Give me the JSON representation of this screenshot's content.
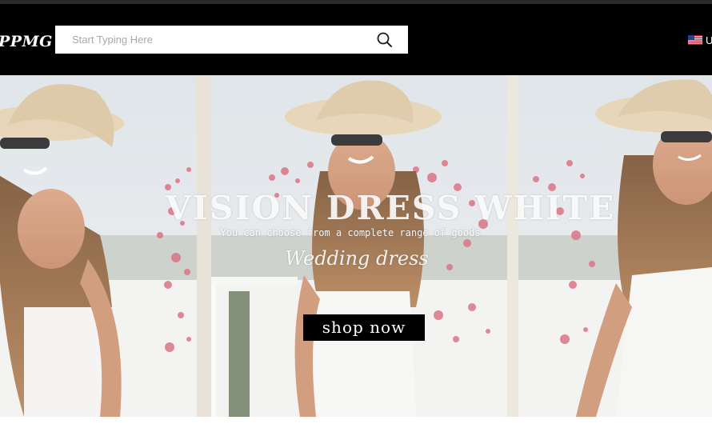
{
  "header": {
    "logo_text": "PPMG",
    "search": {
      "placeholder": "Start Typing Here",
      "icon": "search-icon"
    },
    "region": {
      "flag_icon": "us-flag-icon",
      "label": "U"
    }
  },
  "hero": {
    "title": "VISION DRESS WHITE",
    "subtitle": "You can choose from a complete range of goods",
    "script_text": "Wedding dress",
    "cta_label": "shop now"
  },
  "colors": {
    "header_bg": "#000000",
    "cta_bg": "#000000",
    "hero_text": "#ffffff"
  }
}
